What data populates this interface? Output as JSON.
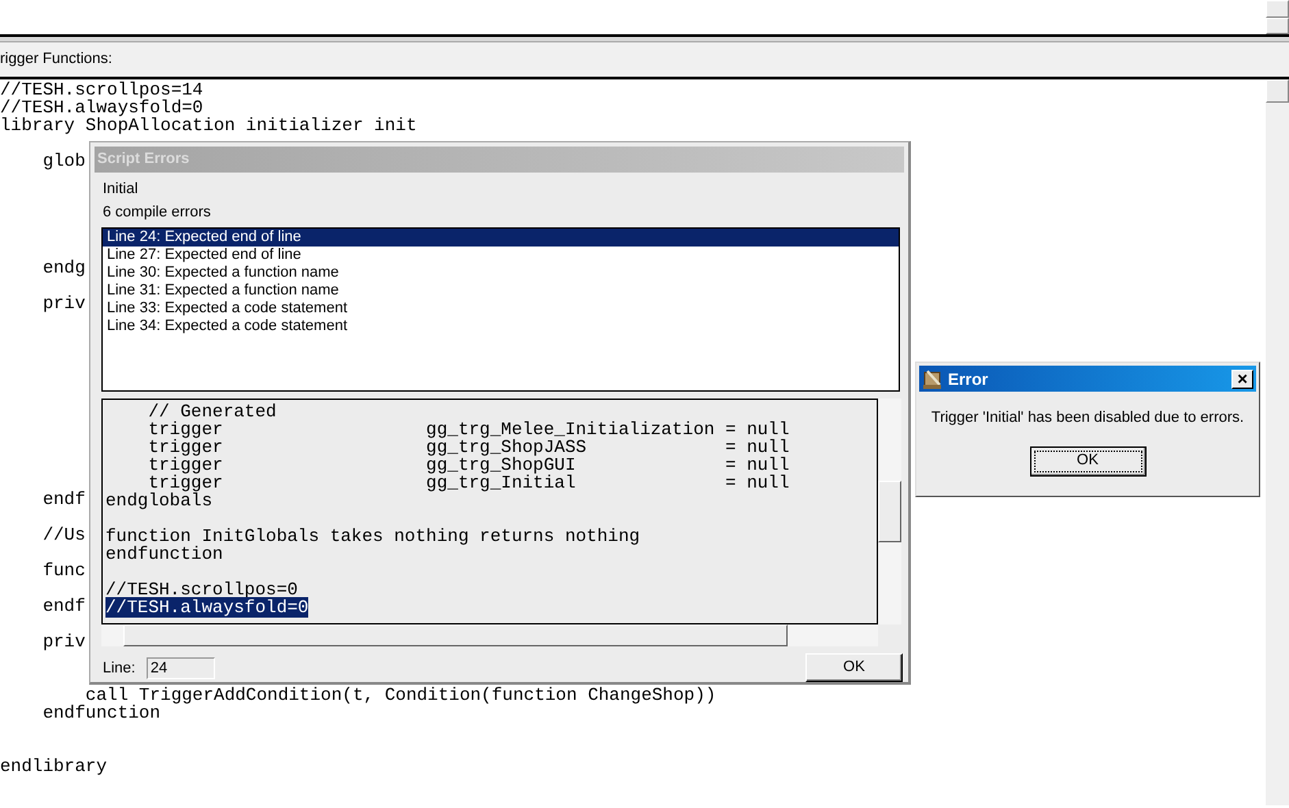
{
  "panel_label": "rigger Functions:",
  "editor_lines": [
    {
      "kind": "code",
      "text": "//TESH.scrollpos=14"
    },
    {
      "kind": "code",
      "text": "//TESH.alwaysfold=0"
    },
    {
      "kind": "code",
      "text": "library ShopAllocation initializer init"
    },
    {
      "kind": "blank"
    },
    {
      "kind": "code",
      "text": "    glob"
    },
    {
      "kind": "blank"
    },
    {
      "kind": "blank"
    },
    {
      "kind": "blank"
    },
    {
      "kind": "blank"
    },
    {
      "kind": "blank"
    },
    {
      "kind": "code",
      "text": "    endg"
    },
    {
      "kind": "blank"
    },
    {
      "kind": "code",
      "text": "    priv"
    },
    {
      "kind": "blank"
    },
    {
      "kind": "blank"
    },
    {
      "kind": "blank"
    },
    {
      "kind": "blank"
    },
    {
      "kind": "blank"
    },
    {
      "kind": "blank"
    },
    {
      "kind": "blank"
    },
    {
      "kind": "blank"
    },
    {
      "kind": "blank"
    },
    {
      "kind": "blank"
    },
    {
      "kind": "code",
      "text": "    endf"
    },
    {
      "kind": "blank"
    },
    {
      "kind": "code",
      "text": "    //Us"
    },
    {
      "kind": "blank"
    },
    {
      "kind": "code",
      "text": "    func"
    },
    {
      "kind": "blank"
    },
    {
      "kind": "code",
      "text": "    endf"
    },
    {
      "kind": "blank"
    },
    {
      "kind": "code",
      "text": "    priv"
    },
    {
      "kind": "blank"
    },
    {
      "kind": "blank"
    },
    {
      "kind": "code",
      "text": "        call TriggerAddCondition(t, Condition(function ChangeShop))"
    },
    {
      "kind": "code",
      "text": "    endfunction"
    },
    {
      "kind": "blank"
    },
    {
      "kind": "blank"
    },
    {
      "kind": "code",
      "text": "endlibrary"
    }
  ],
  "script_errors": {
    "title": "Script Errors",
    "trigger": "Initial",
    "summary": "6 compile errors",
    "errors": [
      {
        "text": "Line  24: Expected end of line",
        "selected": true
      },
      {
        "text": "Line  27: Expected end of line",
        "selected": false
      },
      {
        "text": "Line  30: Expected a function name",
        "selected": false
      },
      {
        "text": "Line  31: Expected a function name",
        "selected": false
      },
      {
        "text": "Line  33: Expected a code statement",
        "selected": false
      },
      {
        "text": "Line  34: Expected a code statement",
        "selected": false
      }
    ],
    "code_lines": [
      {
        "kind": "code",
        "text": "    // Generated"
      },
      {
        "kind": "code",
        "text": "    trigger                   gg_trg_Melee_Initialization = null"
      },
      {
        "kind": "code",
        "text": "    trigger                   gg_trg_ShopJASS             = null"
      },
      {
        "kind": "code",
        "text": "    trigger                   gg_trg_ShopGUI              = null"
      },
      {
        "kind": "code",
        "text": "    trigger                   gg_trg_Initial              = null"
      },
      {
        "kind": "code",
        "text": "endglobals"
      },
      {
        "kind": "blank"
      },
      {
        "kind": "code",
        "text": "function InitGlobals takes nothing returns nothing"
      },
      {
        "kind": "code",
        "text": "endfunction"
      },
      {
        "kind": "blank"
      },
      {
        "kind": "code",
        "text": "//TESH.scrollpos=0"
      },
      {
        "kind": "highlighted",
        "text": "//TESH.alwaysfold=0"
      }
    ],
    "line_label": "Line:",
    "line_value": "24",
    "ok": "OK"
  },
  "error_dialog": {
    "title": "Error",
    "close": "×",
    "message": "Trigger 'Initial' has been disabled due to errors.",
    "ok": "OK"
  }
}
